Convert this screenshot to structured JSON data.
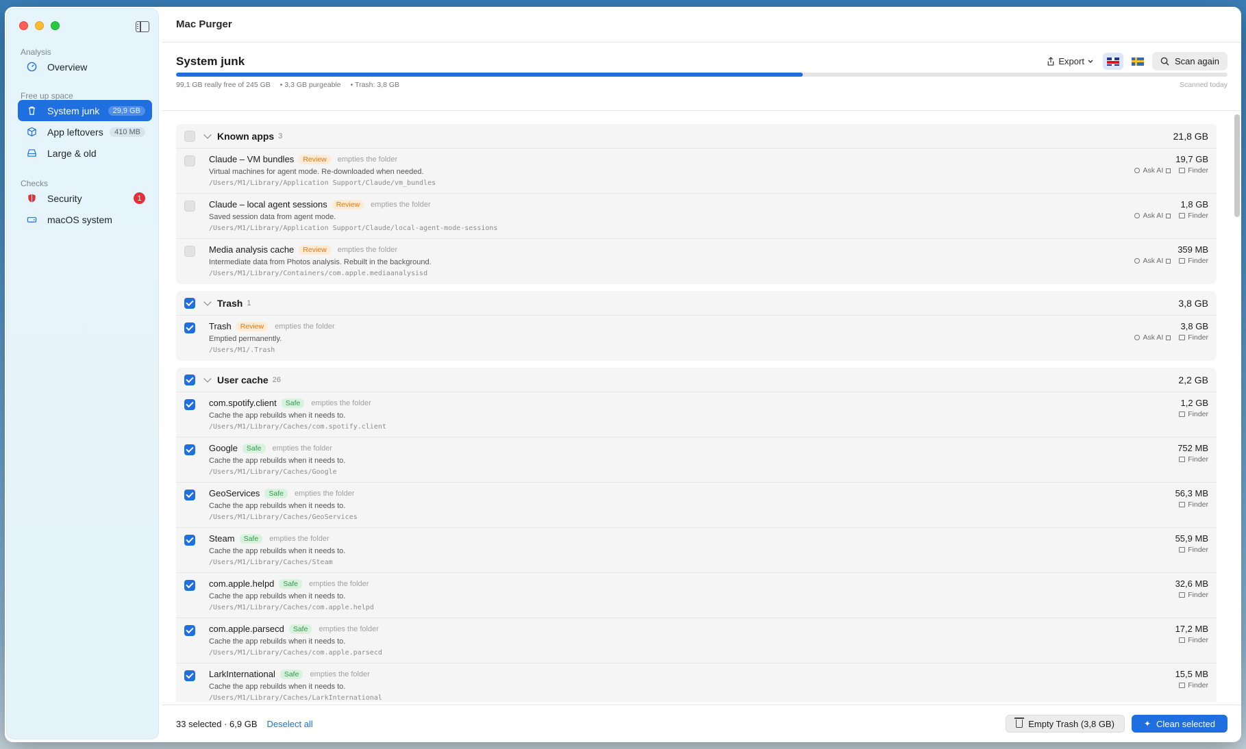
{
  "app": {
    "title": "Mac Purger"
  },
  "sidebar": {
    "sections": [
      {
        "label": "Analysis"
      },
      {
        "label": "Free up space"
      },
      {
        "label": "Checks"
      }
    ],
    "items": [
      {
        "label": "Overview",
        "icon": "gauge-icon"
      },
      {
        "label": "System junk",
        "badge": "29,9 GB",
        "icon": "trash-icon",
        "active": true
      },
      {
        "label": "App leftovers",
        "badge": "410 MB",
        "icon": "cube-icon"
      },
      {
        "label": "Large & old",
        "icon": "drive-icon"
      },
      {
        "label": "Security",
        "alert": "1",
        "icon": "shield-icon"
      },
      {
        "label": "macOS system",
        "icon": "hard-drive-icon"
      }
    ]
  },
  "header": {
    "title": "System junk",
    "export_label": "Export",
    "scan_label": "Scan again",
    "progress_fraction": 0.596,
    "stats": [
      "99,1 GB really free of 245 GB",
      "• 3,3 GB purgeable",
      "• Trash: 3,8 GB"
    ],
    "scanned": "Scanned today",
    "accent_color": "#1f6fe0"
  },
  "labels": {
    "ask_ai": "Ask AI",
    "finder": "Finder"
  },
  "groups": [
    {
      "title": "Known apps",
      "count": "3",
      "size": "21,8 GB",
      "checked": false,
      "items": [
        {
          "name": "Claude – VM bundles",
          "tag": "Review",
          "action": "empties the folder",
          "desc": "Virtual machines for agent mode. Re-downloaded when needed.",
          "path": "/Users/M1/Library/Application Support/Claude/vm_bundles",
          "size": "19,7 GB",
          "ask_ai": true,
          "checked": false
        },
        {
          "name": "Claude – local agent sessions",
          "tag": "Review",
          "action": "empties the folder",
          "desc": "Saved session data from agent mode.",
          "path": "/Users/M1/Library/Application Support/Claude/local-agent-mode-sessions",
          "size": "1,8 GB",
          "ask_ai": true,
          "checked": false
        },
        {
          "name": "Media analysis cache",
          "tag": "Review",
          "action": "empties the folder",
          "desc": "Intermediate data from Photos analysis. Rebuilt in the background.",
          "path": "/Users/M1/Library/Containers/com.apple.mediaanalysisd",
          "size": "359 MB",
          "ask_ai": true,
          "checked": false
        }
      ]
    },
    {
      "title": "Trash",
      "count": "1",
      "size": "3,8 GB",
      "checked": true,
      "items": [
        {
          "name": "Trash",
          "tag": "Review",
          "action": "empties the folder",
          "desc": "Emptied permanently.",
          "path": "/Users/M1/.Trash",
          "size": "3,8 GB",
          "ask_ai": true,
          "checked": true
        }
      ]
    },
    {
      "title": "User cache",
      "count": "26",
      "size": "2,2 GB",
      "checked": true,
      "items": [
        {
          "name": "com.spotify.client",
          "tag": "Safe",
          "action": "empties the folder",
          "desc": "Cache the app rebuilds when it needs to.",
          "path": "/Users/M1/Library/Caches/com.spotify.client",
          "size": "1,2 GB",
          "ask_ai": false,
          "checked": true
        },
        {
          "name": "Google",
          "tag": "Safe",
          "action": "empties the folder",
          "desc": "Cache the app rebuilds when it needs to.",
          "path": "/Users/M1/Library/Caches/Google",
          "size": "752 MB",
          "ask_ai": false,
          "checked": true
        },
        {
          "name": "GeoServices",
          "tag": "Safe",
          "action": "empties the folder",
          "desc": "Cache the app rebuilds when it needs to.",
          "path": "/Users/M1/Library/Caches/GeoServices",
          "size": "56,3 MB",
          "ask_ai": false,
          "checked": true
        },
        {
          "name": "Steam",
          "tag": "Safe",
          "action": "empties the folder",
          "desc": "Cache the app rebuilds when it needs to.",
          "path": "/Users/M1/Library/Caches/Steam",
          "size": "55,9 MB",
          "ask_ai": false,
          "checked": true
        },
        {
          "name": "com.apple.helpd",
          "tag": "Safe",
          "action": "empties the folder",
          "desc": "Cache the app rebuilds when it needs to.",
          "path": "/Users/M1/Library/Caches/com.apple.helpd",
          "size": "32,6 MB",
          "ask_ai": false,
          "checked": true
        },
        {
          "name": "com.apple.parsecd",
          "tag": "Safe",
          "action": "empties the folder",
          "desc": "Cache the app rebuilds when it needs to.",
          "path": "/Users/M1/Library/Caches/com.apple.parsecd",
          "size": "17,2 MB",
          "ask_ai": false,
          "checked": true
        },
        {
          "name": "LarkInternational",
          "tag": "Safe",
          "action": "empties the folder",
          "desc": "Cache the app rebuilds when it needs to.",
          "path": "/Users/M1/Library/Caches/LarkInternational",
          "size": "15,5 MB",
          "ask_ai": false,
          "checked": true
        }
      ]
    }
  ],
  "footer": {
    "selection": "33 selected · 6,9 GB",
    "deselect_label": "Deselect all",
    "empty_trash_label": "Empty Trash (3,8 GB)",
    "clean_label": "Clean selected"
  }
}
